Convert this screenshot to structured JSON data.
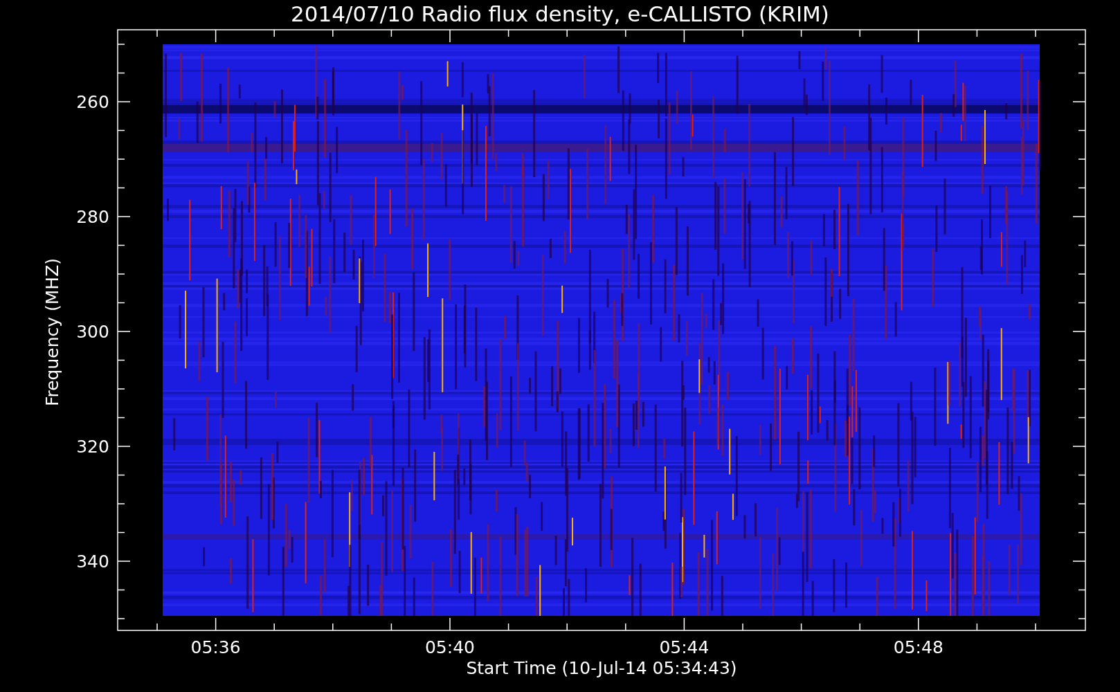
{
  "title": "2014/07/10  Radio flux density, e-CALLISTO (KRIM)",
  "ylabel": "Frequency (MHZ)",
  "xlabel": "Start Time (10-Jul-14 05:34:43)",
  "yticks": [
    "260",
    "280",
    "300",
    "320",
    "340"
  ],
  "xticks": [
    "05:36",
    "05:40",
    "05:44",
    "05:48"
  ]
}
